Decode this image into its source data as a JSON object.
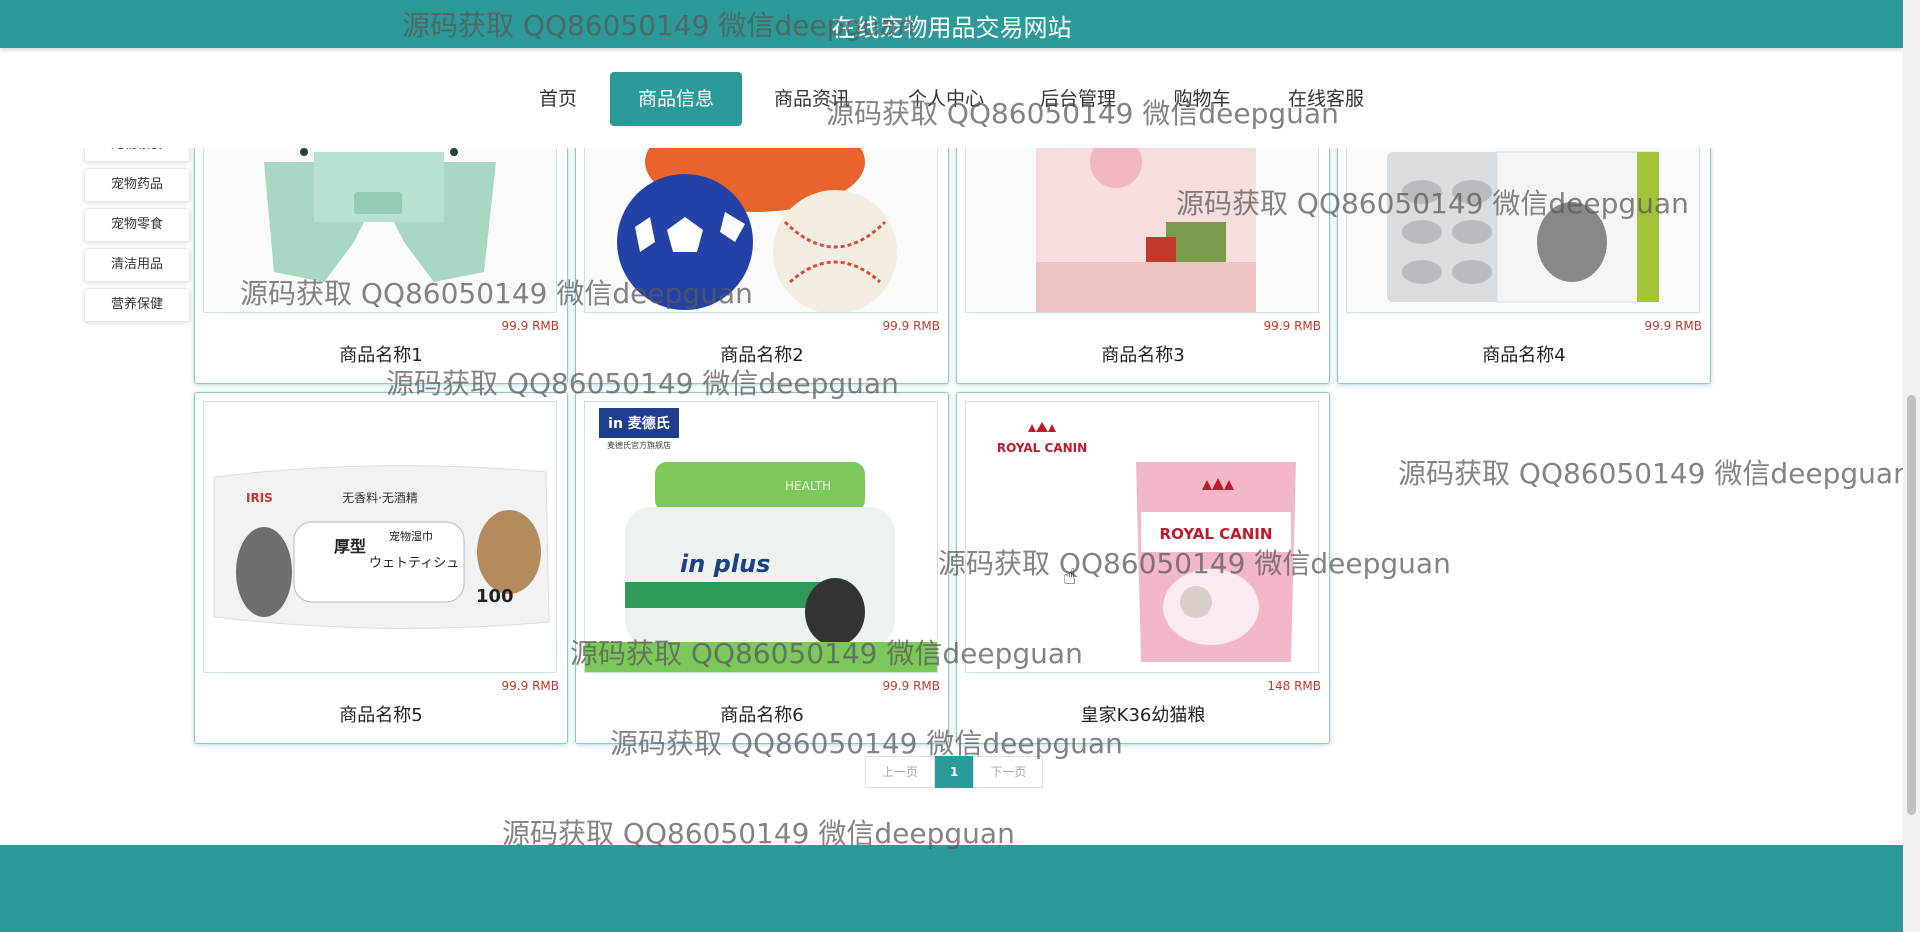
{
  "header": {
    "site_title": "在线宠物用品交易网站"
  },
  "nav": {
    "items": [
      {
        "label": "首页"
      },
      {
        "label": "商品信息",
        "active": true
      },
      {
        "label": "商品资讯"
      },
      {
        "label": "个人中心"
      },
      {
        "label": "后台管理"
      },
      {
        "label": "购物车"
      },
      {
        "label": "在线客服"
      }
    ]
  },
  "sidebar": {
    "categories": [
      {
        "label": "宠物粮食"
      },
      {
        "label": "宠物药品"
      },
      {
        "label": "宠物零食"
      },
      {
        "label": "清洁用品"
      },
      {
        "label": "营养保健"
      }
    ]
  },
  "products": [
    {
      "name": "商品名称1",
      "price": "99.9 RMB",
      "image": "pet-clothing"
    },
    {
      "name": "商品名称2",
      "price": "99.9 RMB",
      "image": "pet-toy-balls"
    },
    {
      "name": "商品名称3",
      "price": "99.9 RMB",
      "image": "pet-food-bag"
    },
    {
      "name": "商品名称4",
      "price": "99.9 RMB",
      "image": "pet-medicine-box"
    },
    {
      "name": "商品名称5",
      "price": "99.9 RMB",
      "image": "pet-wipes"
    },
    {
      "name": "商品名称6",
      "price": "99.9 RMB",
      "image": "supplement-jar"
    },
    {
      "name": "皇家K36幼猫粮",
      "price": "148 RMB",
      "image": "royal-canin-bag"
    }
  ],
  "pagination": {
    "prev": "上一页",
    "current": "1",
    "next": "下一页"
  },
  "watermark": "源码获取 QQ86050149 微信deepguan",
  "images": {
    "wipes_text1": "无香料·无酒精",
    "wipes_text2": "宠物湿巾",
    "wipes_text3": "厚型",
    "wipes_text4": "ウェトティシュ",
    "wipes_count": "100",
    "wipes_brand": "IRIS",
    "jar_brand": "in 麦德氏",
    "jar_sub": "麦德氏官方旗舰店",
    "jar_health": "HEALTH",
    "jar_plus": "in plus",
    "royal_brand": "ROYAL CANIN"
  },
  "colors": {
    "primary": "#2b9a98",
    "price": "#c0392b"
  }
}
